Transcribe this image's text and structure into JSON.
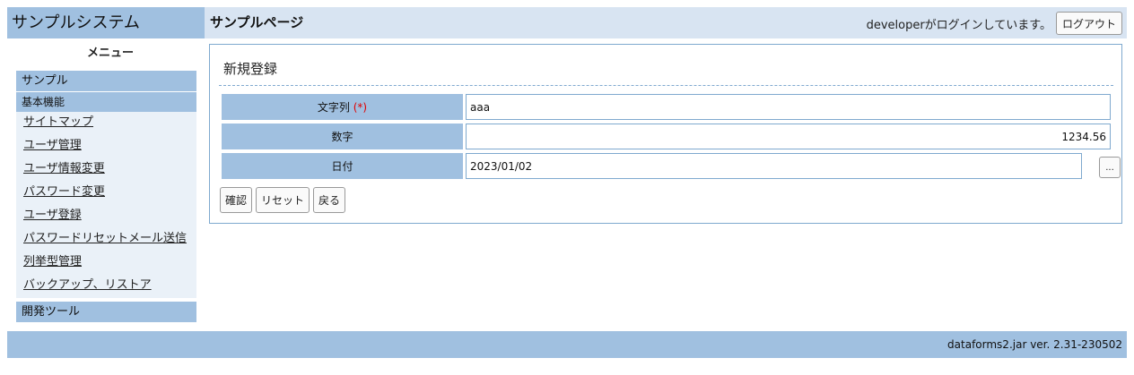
{
  "header": {
    "site_title": "サンプルシステム",
    "page_title": "サンプルページ",
    "login_message": "developerがログインしています。",
    "logout_label": "ログアウト"
  },
  "sidebar": {
    "caption": "メニュー",
    "group_sample": "サンプル",
    "group_basic": "基本機能",
    "items": [
      "サイトマップ",
      "ユーザ管理",
      "ユーザ情報変更",
      "パスワード変更",
      "ユーザ登録",
      "パスワードリセットメール送信",
      "列挙型管理",
      "バックアップ、リストア"
    ],
    "group_devtools": "開発ツール"
  },
  "form": {
    "title": "新規登録",
    "fields": [
      {
        "label": "文字列",
        "required_mark": "(*)",
        "value": "aaa"
      },
      {
        "label": "数字",
        "value": "1234.56"
      },
      {
        "label": "日付",
        "value": "2023/01/02"
      }
    ],
    "picker_label": "...",
    "buttons": {
      "confirm": "確認",
      "reset": "リセット",
      "back": "戻る"
    }
  },
  "footer": {
    "version": "dataforms2.jar ver. 2.31-230502"
  }
}
